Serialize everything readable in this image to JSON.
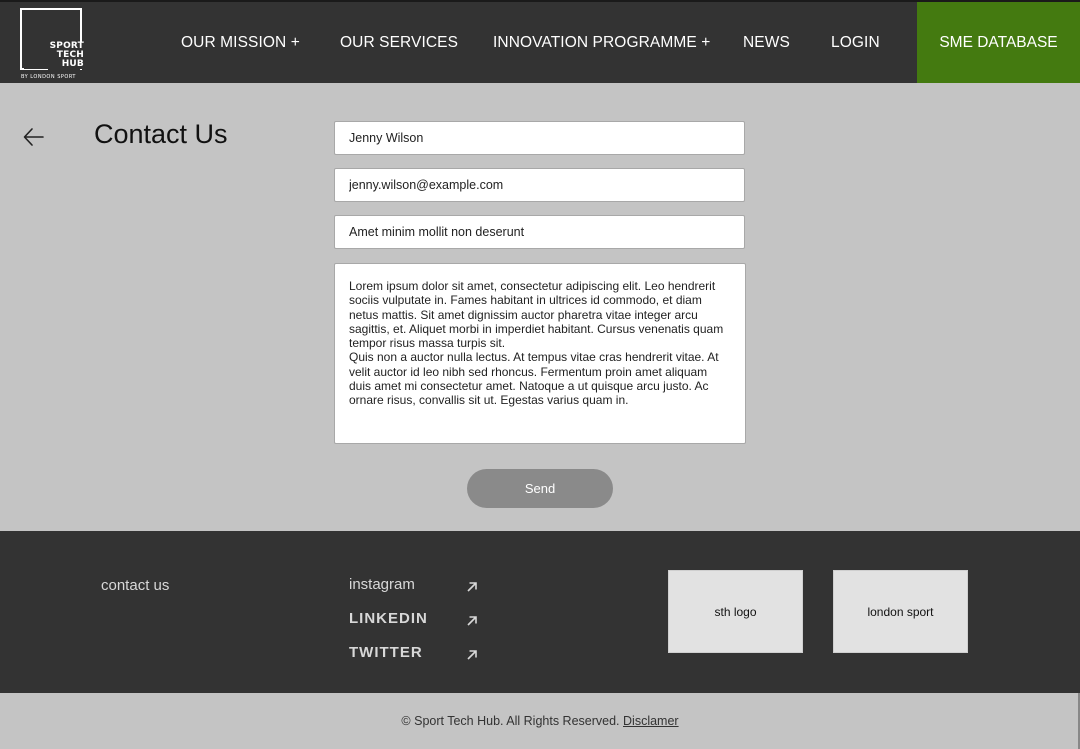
{
  "header": {
    "logo": {
      "line1": "SPORT",
      "line2": "TECH",
      "line3": "HUB",
      "sub": "BY LONDON SPORT"
    },
    "nav": {
      "mission": "OUR MISSION  +",
      "services": "OUR SERVICES",
      "innovation": "INNOVATION PROGRAMME +",
      "news": "NEWS",
      "login": "LOGIN",
      "sme": "SME DATABASE"
    },
    "accent_color": "#447a10"
  },
  "main": {
    "back_icon": "arrow-left-icon",
    "title": "Contact Us",
    "form": {
      "name_value": "Jenny Wilson",
      "email_value": "jenny.wilson@example.com",
      "subject_value": "Amet minim mollit non deserunt",
      "message_value": "Lorem ipsum dolor sit amet, consectetur adipiscing elit. Leo hendrerit sociis vulputate in. Fames habitant in ultrices id commodo, et diam netus mattis. Sit amet dignissim auctor pharetra vitae integer arcu sagittis, et. Aliquet morbi in imperdiet habitant. Cursus venenatis quam tempor risus massa turpis sit.\nQuis non a auctor nulla lectus. At tempus vitae cras hendrerit vitae. At velit auctor id leo nibh sed rhoncus. Fermentum proin amet aliquam duis amet mi consectetur amet. Natoque a ut quisque arcu justo. Ac ornare risus, convallis sit ut. Egestas varius quam in.",
      "send_label": "Send"
    }
  },
  "footer": {
    "contact_label": "contact us",
    "social": {
      "instagram": "instagram",
      "linkedin": "LINKEDIN",
      "twitter": "TWITTER",
      "icon": "external-link-arrow-icon"
    },
    "logos": {
      "sth": "sth logo",
      "london": "london sport"
    }
  },
  "bottom": {
    "copyright": "© Sport Tech Hub. All Rights Reserved.",
    "disclaimer": "Disclamer"
  }
}
